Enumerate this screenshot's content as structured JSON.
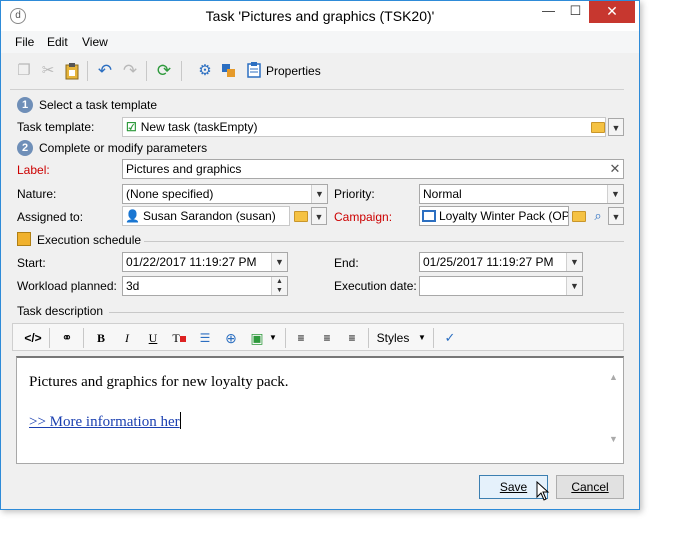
{
  "window": {
    "title": "Task 'Pictures and graphics (TSK20)'",
    "controls": {
      "minimize": "—",
      "maximize": "☐",
      "close": "✕"
    }
  },
  "menu": [
    "File",
    "Edit",
    "View"
  ],
  "toolbar": {
    "properties_label": "Properties"
  },
  "steps": {
    "step1_number": "1",
    "step1_text": "Select a task template",
    "step2_number": "2",
    "step2_text": "Complete or modify parameters"
  },
  "form": {
    "task_template_label": "Task template:",
    "task_template_value": "New task (taskEmpty)",
    "label_label": "Label:",
    "label_value": "Pictures and graphics",
    "nature_label": "Nature:",
    "nature_value": "(None specified)",
    "priority_label": "Priority:",
    "priority_value": "Normal",
    "assigned_label": "Assigned to:",
    "assigned_value": "Susan Sarandon (susan)",
    "campaign_label": "Campaign:",
    "campaign_value": "Loyalty Winter Pack (OP"
  },
  "schedule": {
    "section_title": "Execution schedule",
    "start_label": "Start:",
    "start_value": "01/22/2017 11:19:27 PM",
    "end_label": "End:",
    "end_value": "01/25/2017 11:19:27 PM",
    "workload_label": "Workload planned:",
    "workload_value": "3d",
    "execution_date_label": "Execution date:",
    "execution_date_value": ""
  },
  "description": {
    "section_title": "Task description",
    "styles_label": "Styles",
    "text": "Pictures and graphics for new loyalty pack.",
    "link_text": ">> More information her"
  },
  "buttons": {
    "save": "Save",
    "cancel": "Cancel"
  },
  "colors": {
    "required_label": "#cc0000",
    "window_border": "#2e8bd8",
    "close_button": "#c7372f",
    "link": "#1a3fb0"
  }
}
